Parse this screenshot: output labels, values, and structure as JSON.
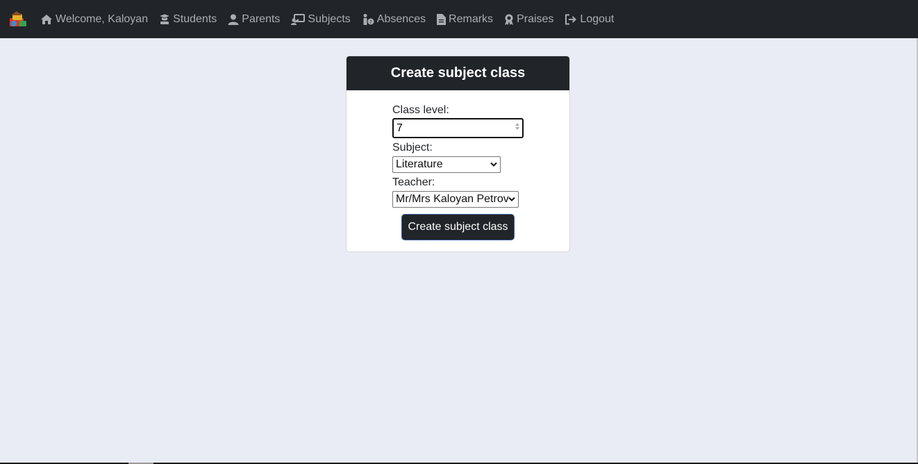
{
  "nav": {
    "items": [
      {
        "label": "Welcome, Kaloyan",
        "icon": "home-icon"
      },
      {
        "label": "Students",
        "icon": "graduation-cap-icon"
      },
      {
        "label": "Parents",
        "icon": "user-icon"
      },
      {
        "label": "Subjects",
        "icon": "teacher-board-icon"
      },
      {
        "label": "Absences",
        "icon": "person-question-icon"
      },
      {
        "label": "Remarks",
        "icon": "document-icon"
      },
      {
        "label": "Praises",
        "icon": "award-icon"
      },
      {
        "label": "Logout",
        "icon": "logout-icon"
      }
    ]
  },
  "form": {
    "title": "Create subject class",
    "class_level_label": "Class level:",
    "class_level_value": "7",
    "subject_label": "Subject:",
    "subject_value": "Literature",
    "teacher_label": "Teacher:",
    "teacher_value": "Mr/Mrs Kaloyan Petrov",
    "submit_label": "Create subject class"
  },
  "colors": {
    "navbar": "#212529",
    "background": "#e9ecf5",
    "nav_text": "#a9adb2",
    "button": "#212529"
  }
}
